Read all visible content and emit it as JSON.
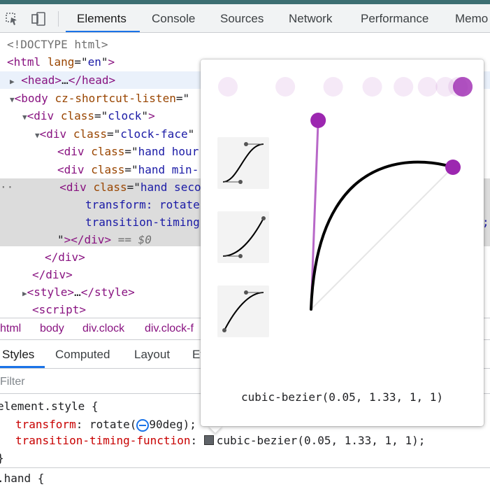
{
  "tabs": [
    {
      "label": "Elements",
      "active": true
    },
    {
      "label": "Console"
    },
    {
      "label": "Sources"
    },
    {
      "label": "Network"
    },
    {
      "label": "Performance"
    },
    {
      "label": "Memo"
    }
  ],
  "tree": {
    "doctype": "<!DOCTYPE html>",
    "html_open": {
      "tag": "html",
      "attr": "lang",
      "val": "en"
    },
    "head": {
      "open": "<head>",
      "ellipsis": "…",
      "close": "</head>"
    },
    "body": {
      "tag": "body",
      "attr": "cz-shortcut-listen",
      "rest": "=\""
    },
    "div_clock": {
      "tag": "div",
      "attr": "class",
      "val": "clock"
    },
    "div_face": {
      "tag": "div",
      "attr": "class",
      "val": "clock-face"
    },
    "hand_hour": {
      "tag": "div",
      "attr": "class",
      "val": "hand hour"
    },
    "hand_min": {
      "tag": "div",
      "attr": "class",
      "val": "hand min-"
    },
    "hand_sec": {
      "tag": "div",
      "attr": "class",
      "val": "hand seco"
    },
    "sec_style1": "transform: rotate",
    "sec_style2": "transition-timing",
    "sec_style_end": ";",
    "sec_close": "></div>",
    "sec_eq": " == $0",
    "close_div1": "</div>",
    "close_div2": "</div>",
    "style_line": {
      "open": "<style>",
      "ellipsis": "…",
      "close": "</style>"
    },
    "script_line": "<script>"
  },
  "breadcrumbs": [
    "html",
    "body",
    "div.clock",
    "div.clock-f"
  ],
  "style_tabs": [
    "Styles",
    "Computed",
    "Layout",
    "Ev"
  ],
  "filter_placeholder": "Filter",
  "rules": {
    "element_style": "element.style {",
    "prop1": "transform",
    "val1_pre": "rotate(",
    "val1_post": "90deg);",
    "prop2": "transition-timing-function",
    "val2": "cubic-bezier(0.05, 1.33, 1, 1);",
    "close": "}",
    "hand": ".hand {"
  },
  "bezier": {
    "label": "cubic-bezier(0.05, 1.33, 1, 1)",
    "p1": [
      0.05,
      1.33
    ],
    "p2": [
      1,
      1
    ],
    "accent": "#9c27b0"
  },
  "presets": [
    "ease-in-out",
    "ease-in",
    "ease-out"
  ]
}
